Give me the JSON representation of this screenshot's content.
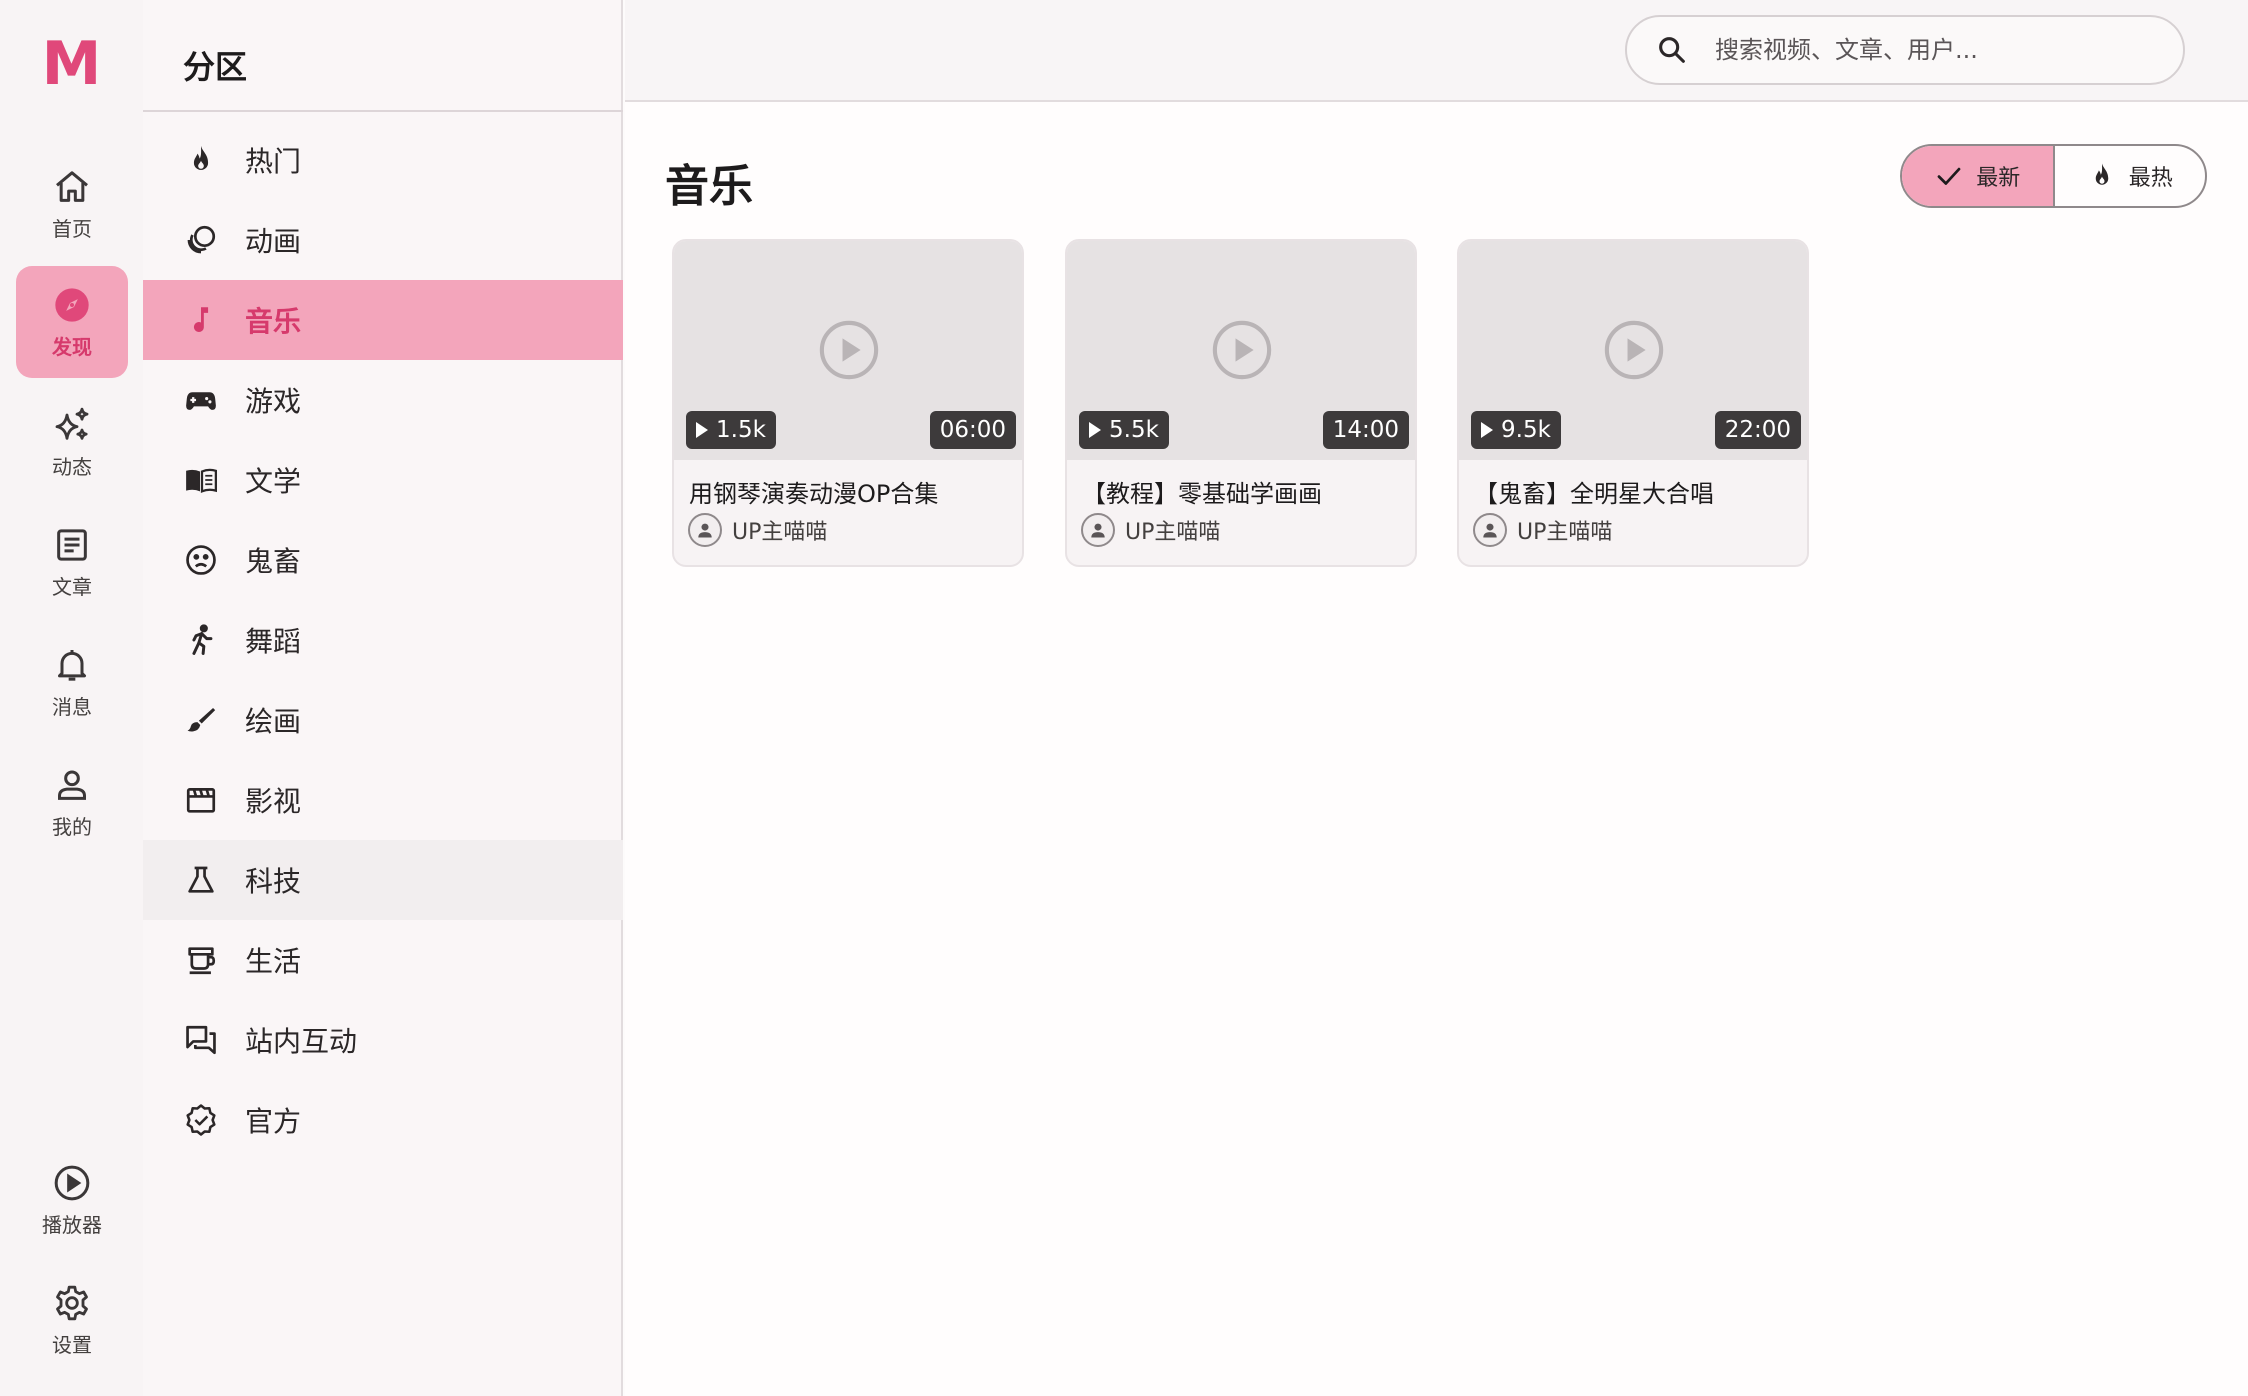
{
  "brand": {
    "logo": "M",
    "accent": "#e0487a",
    "active_bg": "#f3a5bb"
  },
  "rail": {
    "items": [
      {
        "label": "首页",
        "icon": "home-icon"
      },
      {
        "label": "发现",
        "icon": "compass-icon",
        "active": true
      },
      {
        "label": "动态",
        "icon": "sparkle-icon"
      },
      {
        "label": "文章",
        "icon": "article-icon"
      },
      {
        "label": "消息",
        "icon": "bell-icon"
      },
      {
        "label": "我的",
        "icon": "person-icon"
      }
    ],
    "bottom": [
      {
        "label": "播放器",
        "icon": "play-circle-icon"
      },
      {
        "label": "设置",
        "icon": "gear-icon"
      }
    ]
  },
  "panel": {
    "title": "分区",
    "categories": [
      {
        "label": "热门",
        "icon": "fire-icon"
      },
      {
        "label": "动画",
        "icon": "animation-icon"
      },
      {
        "label": "音乐",
        "icon": "music-note-icon",
        "active": true
      },
      {
        "label": "游戏",
        "icon": "gamepad-icon"
      },
      {
        "label": "文学",
        "icon": "book-icon"
      },
      {
        "label": "鬼畜",
        "icon": "sad-face-icon"
      },
      {
        "label": "舞蹈",
        "icon": "dancer-icon"
      },
      {
        "label": "绘画",
        "icon": "brush-icon"
      },
      {
        "label": "影视",
        "icon": "clapperboard-icon"
      },
      {
        "label": "科技",
        "icon": "flask-icon",
        "hover": true
      },
      {
        "label": "生活",
        "icon": "cup-icon"
      },
      {
        "label": "站内互动",
        "icon": "chat-icon"
      },
      {
        "label": "官方",
        "icon": "verified-icon"
      }
    ]
  },
  "search": {
    "placeholder": "搜索视频、文章、用户..."
  },
  "main": {
    "title": "音乐",
    "sort": {
      "newest": "最新",
      "hottest": "最热",
      "selected": "newest"
    },
    "videos": [
      {
        "title": "用钢琴演奏动漫OP合集",
        "views": "1.5k",
        "duration": "06:00",
        "uploader": "UP主喵喵"
      },
      {
        "title": "【教程】零基础学画画",
        "views": "5.5k",
        "duration": "14:00",
        "uploader": "UP主喵喵"
      },
      {
        "title": "【鬼畜】全明星大合唱",
        "views": "9.5k",
        "duration": "22:00",
        "uploader": "UP主喵喵"
      }
    ]
  }
}
